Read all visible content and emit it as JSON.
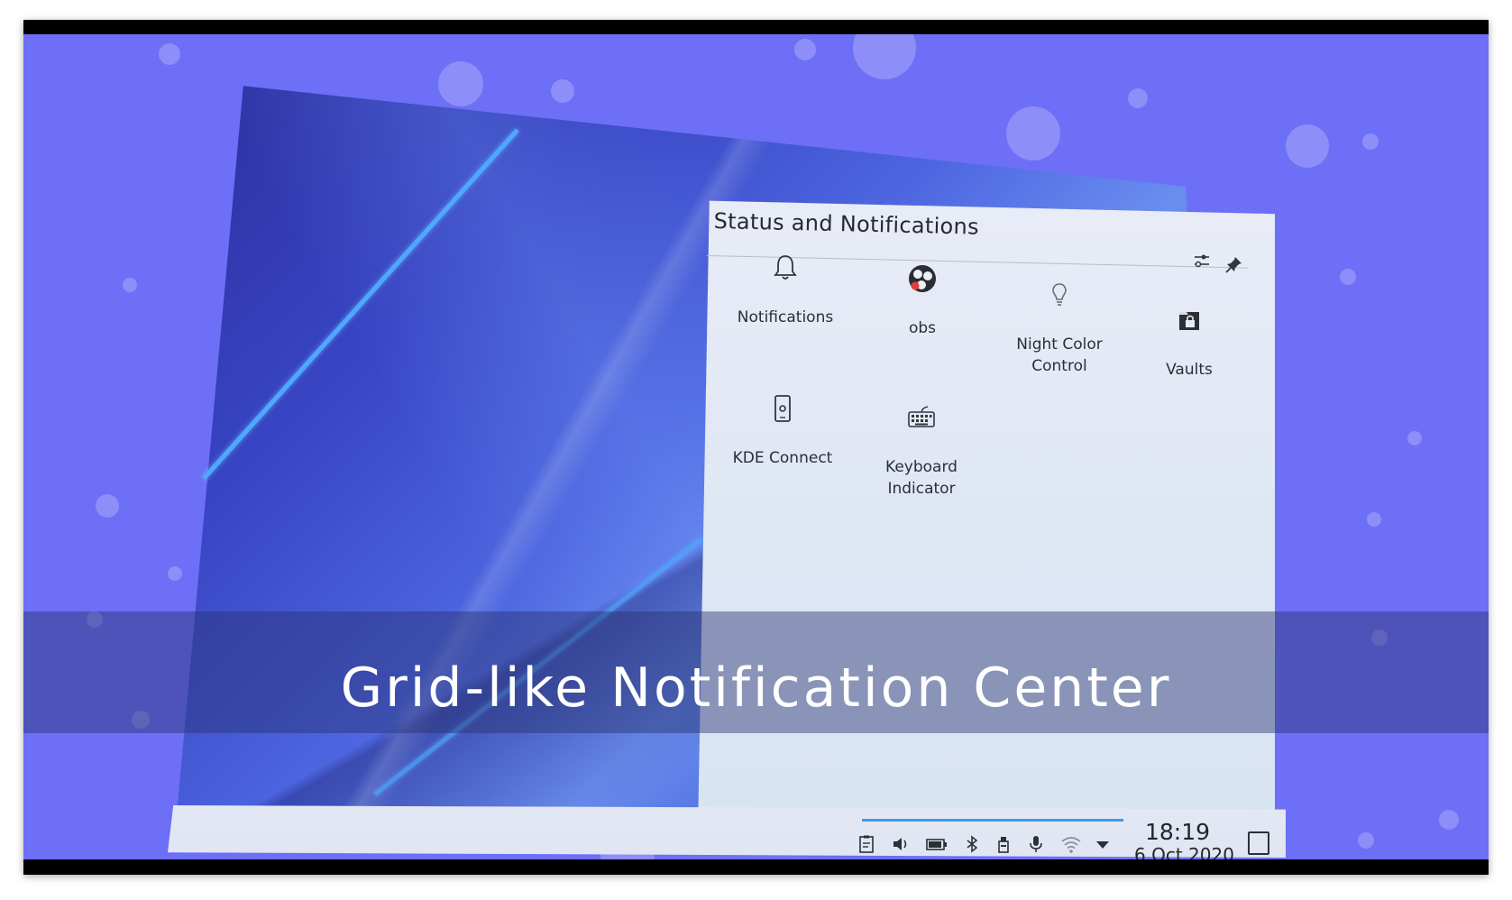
{
  "panel": {
    "title": "Status and Notifications",
    "configure_icon": "configure-icon",
    "pin_icon": "pin-icon"
  },
  "tiles": [
    {
      "label": "Notifications",
      "icon": "bell-icon"
    },
    {
      "label": "obs",
      "icon": "obs-icon"
    },
    {
      "label": "Night Color Control",
      "icon": "lightbulb-icon"
    },
    {
      "label": "Vaults",
      "icon": "vault-lock-icon"
    },
    {
      "label": "KDE Connect",
      "icon": "phone-icon"
    },
    {
      "label": "Keyboard Indicator",
      "icon": "keyboard-icon"
    }
  ],
  "taskbar": {
    "tray_icons": [
      "clipboard-icon",
      "volume-icon",
      "battery-icon",
      "bluetooth-icon",
      "usb-device-icon",
      "microphone-icon",
      "wifi-icon",
      "expand-arrow-icon"
    ],
    "time": "18:19",
    "date": "6 Oct 2020"
  },
  "caption": "Grid-like Notification Center",
  "colors": {
    "background": "#6d6ff6",
    "accent": "#3d9be8",
    "panel": "#e6eaf5",
    "obs_red": "#e33b3b"
  }
}
